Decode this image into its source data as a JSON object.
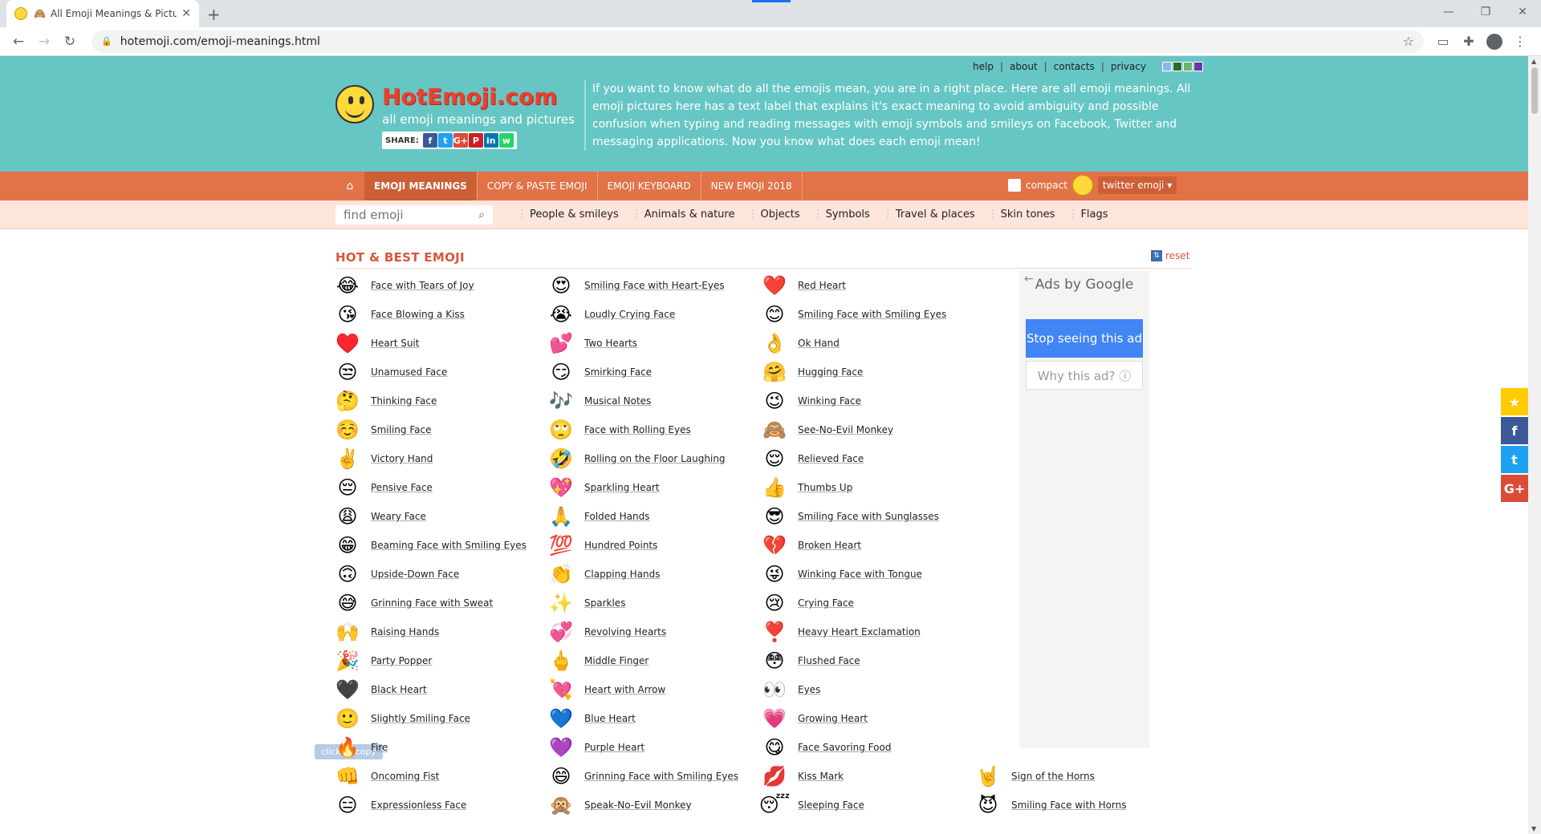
{
  "browser": {
    "tab_title": "All Emoji Meanings & Picture",
    "url": "hotemoji.com/emoji-meanings.html"
  },
  "header": {
    "top_links": [
      "help",
      "about",
      "contacts",
      "privacy"
    ],
    "swatch_colors": [
      "#8fb6e8",
      "#2b6b2b",
      "#6db26d",
      "#6b36a6"
    ],
    "logo_title": "HotEmoji.com",
    "logo_subtitle": "all emoji meanings and pictures",
    "share_label": "SHARE:",
    "share_buttons": [
      {
        "name": "facebook",
        "glyph": "f",
        "color": "#3b5998"
      },
      {
        "name": "twitter",
        "glyph": "t",
        "color": "#1da1f2"
      },
      {
        "name": "google-plus",
        "glyph": "G+",
        "color": "#dd4b39"
      },
      {
        "name": "pinterest",
        "glyph": "P",
        "color": "#cb2027"
      },
      {
        "name": "linkedin",
        "glyph": "in",
        "color": "#0077b5"
      },
      {
        "name": "whatsapp",
        "glyph": "w",
        "color": "#25d366"
      }
    ],
    "intro": "If you want to know what do all the emojis mean, you are in a right place. Here are all emoji meanings. All emoji pictures here has a text label that explains it's exact meaning to avoid ambiguity and possible confusion when typing and reading messages with emoji symbols and smileys on Facebook, Twitter and messaging applications. Now you know what does each emoji mean!"
  },
  "menu": {
    "items": [
      "EMOJI MEANINGS",
      "COPY & PASTE EMOJI",
      "EMOJI KEYBOARD",
      "NEW EMOJI 2018"
    ],
    "compact_label": "compact",
    "style_select": "twitter emoji ▾"
  },
  "catbar": {
    "search_placeholder": "find emoji",
    "categories": [
      "People & smileys",
      "Animals & nature",
      "Objects",
      "Symbols",
      "Travel & places",
      "Skin tones",
      "Flags"
    ]
  },
  "section": {
    "title": "HOT & BEST EMOJI",
    "reset_label": "reset"
  },
  "columns": [
    [
      {
        "e": "😂",
        "label": "Face with Tears of Joy"
      },
      {
        "e": "😘",
        "label": "Face Blowing a Kiss"
      },
      {
        "e": "♥️",
        "label": "Heart Suit"
      },
      {
        "e": "😒",
        "label": "Unamused Face"
      },
      {
        "e": "🤔",
        "label": "Thinking Face"
      },
      {
        "e": "☺️",
        "label": "Smiling Face"
      },
      {
        "e": "✌️",
        "label": "Victory Hand"
      },
      {
        "e": "😔",
        "label": "Pensive Face"
      },
      {
        "e": "😩",
        "label": "Weary Face"
      },
      {
        "e": "😁",
        "label": "Beaming Face with Smiling Eyes"
      },
      {
        "e": "🙃",
        "label": "Upside-Down Face"
      },
      {
        "e": "😅",
        "label": "Grinning Face with Sweat"
      },
      {
        "e": "🙌",
        "label": "Raising Hands"
      },
      {
        "e": "🎉",
        "label": "Party Popper"
      },
      {
        "e": "🖤",
        "label": "Black Heart"
      },
      {
        "e": "🙂",
        "label": "Slightly Smiling Face"
      },
      {
        "e": "🔥",
        "label": "Fire"
      },
      {
        "e": "👊",
        "label": "Oncoming Fist"
      },
      {
        "e": "😑",
        "label": "Expressionless Face"
      }
    ],
    [
      {
        "e": "😍",
        "label": "Smiling Face with Heart-Eyes"
      },
      {
        "e": "😭",
        "label": "Loudly Crying Face"
      },
      {
        "e": "💕",
        "label": "Two Hearts"
      },
      {
        "e": "😏",
        "label": "Smirking Face"
      },
      {
        "e": "🎶",
        "label": "Musical Notes"
      },
      {
        "e": "🙄",
        "label": "Face with Rolling Eyes"
      },
      {
        "e": "🤣",
        "label": "Rolling on the Floor Laughing"
      },
      {
        "e": "💖",
        "label": "Sparkling Heart"
      },
      {
        "e": "🙏",
        "label": "Folded Hands"
      },
      {
        "e": "💯",
        "label": "Hundred Points"
      },
      {
        "e": "👏",
        "label": "Clapping Hands"
      },
      {
        "e": "✨",
        "label": "Sparkles"
      },
      {
        "e": "💞",
        "label": "Revolving Hearts"
      },
      {
        "e": "🖕",
        "label": "Middle Finger"
      },
      {
        "e": "💘",
        "label": "Heart with Arrow"
      },
      {
        "e": "💙",
        "label": "Blue Heart"
      },
      {
        "e": "💜",
        "label": "Purple Heart"
      },
      {
        "e": "😄",
        "label": "Grinning Face with Smiling Eyes"
      },
      {
        "e": "🙊",
        "label": "Speak-No-Evil Monkey"
      }
    ],
    [
      {
        "e": "❤️",
        "label": "Red Heart"
      },
      {
        "e": "😊",
        "label": "Smiling Face with Smiling Eyes"
      },
      {
        "e": "👌",
        "label": "Ok Hand"
      },
      {
        "e": "🤗",
        "label": "Hugging Face"
      },
      {
        "e": "😉",
        "label": "Winking Face"
      },
      {
        "e": "🙈",
        "label": "See-No-Evil Monkey"
      },
      {
        "e": "😌",
        "label": "Relieved Face"
      },
      {
        "e": "👍",
        "label": "Thumbs Up"
      },
      {
        "e": "😎",
        "label": "Smiling Face with Sunglasses"
      },
      {
        "e": "💔",
        "label": "Broken Heart"
      },
      {
        "e": "😜",
        "label": "Winking Face with Tongue"
      },
      {
        "e": "😢",
        "label": "Crying Face"
      },
      {
        "e": "❣️",
        "label": "Heavy Heart Exclamation"
      },
      {
        "e": "😳",
        "label": "Flushed Face"
      },
      {
        "e": "👀",
        "label": "Eyes"
      },
      {
        "e": "💗",
        "label": "Growing Heart"
      },
      {
        "e": "😋",
        "label": "Face Savoring Food"
      },
      {
        "e": "💋",
        "label": "Kiss Mark"
      },
      {
        "e": "😴",
        "label": "Sleeping Face"
      }
    ],
    [
      {
        "e": "🤘",
        "label": "Sign of the Horns"
      },
      {
        "e": "😈",
        "label": "Smiling Face with Horns"
      }
    ]
  ],
  "ad": {
    "ads_by": "Ads by Google",
    "stop": "Stop seeing this ad",
    "why": "Why this ad? ⓘ"
  },
  "tooltip": "click to copy",
  "float_share": [
    {
      "name": "favorite",
      "glyph": "★",
      "color": "#ffcc00"
    },
    {
      "name": "facebook",
      "glyph": "f",
      "color": "#3b5998"
    },
    {
      "name": "twitter",
      "glyph": "t",
      "color": "#1da1f2"
    },
    {
      "name": "google-plus",
      "glyph": "G+",
      "color": "#dd4b39"
    }
  ]
}
